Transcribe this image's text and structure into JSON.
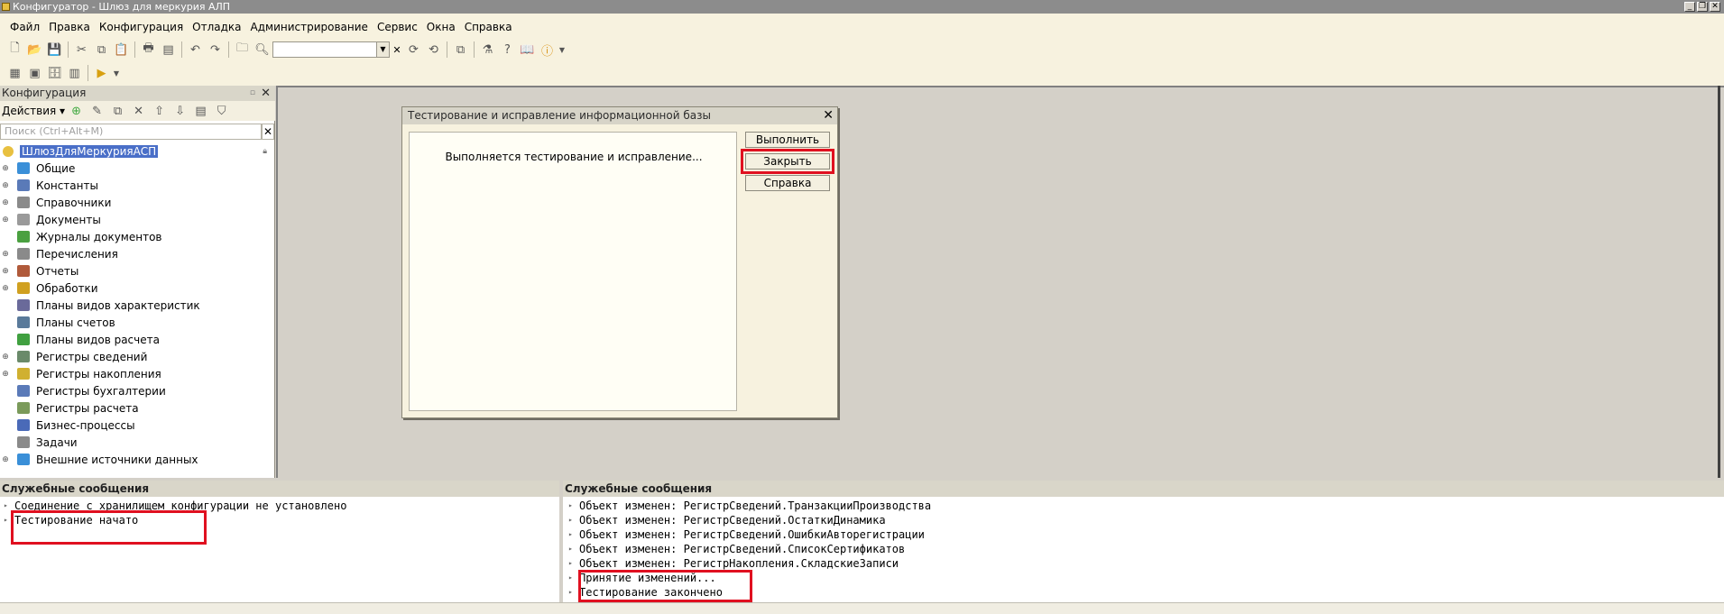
{
  "window": {
    "title": "Конфигуратор - Шлюз для меркурия АЛП"
  },
  "menu": [
    "Файл",
    "Правка",
    "Конфигурация",
    "Отладка",
    "Администрирование",
    "Сервис",
    "Окна",
    "Справка"
  ],
  "config_panel": {
    "title": "Конфигурация",
    "actions_label": "Действия",
    "search_placeholder": "Поиск (Ctrl+Alt+M)",
    "root": "ШлюзДляМеркурияАСП",
    "items": [
      {
        "label": "Общие",
        "expandable": true,
        "icon": "common-icon",
        "color": "#3a8fd8"
      },
      {
        "label": "Константы",
        "expandable": true,
        "icon": "constants-icon",
        "color": "#5a7ab8"
      },
      {
        "label": "Справочники",
        "expandable": true,
        "icon": "catalogs-icon",
        "color": "#8a8a8a"
      },
      {
        "label": "Документы",
        "expandable": true,
        "icon": "documents-icon",
        "color": "#9a9a9a"
      },
      {
        "label": "Журналы документов",
        "expandable": false,
        "icon": "journals-icon",
        "color": "#4aa040"
      },
      {
        "label": "Перечисления",
        "expandable": true,
        "icon": "enums-icon",
        "color": "#8a8a8a"
      },
      {
        "label": "Отчеты",
        "expandable": true,
        "icon": "reports-icon",
        "color": "#b05a3a"
      },
      {
        "label": "Обработки",
        "expandable": true,
        "icon": "dataprocessors-icon",
        "color": "#d0a020"
      },
      {
        "label": "Планы видов характеристик",
        "expandable": false,
        "icon": "charts-of-characteristics-icon",
        "color": "#6a6a9a"
      },
      {
        "label": "Планы счетов",
        "expandable": false,
        "icon": "charts-of-accounts-icon",
        "color": "#5a7a9a"
      },
      {
        "label": "Планы видов расчета",
        "expandable": false,
        "icon": "charts-of-calculation-icon",
        "color": "#40a040"
      },
      {
        "label": "Регистры сведений",
        "expandable": true,
        "icon": "info-registers-icon",
        "color": "#6a8a6a"
      },
      {
        "label": "Регистры накопления",
        "expandable": true,
        "icon": "accum-registers-icon",
        "color": "#d0b030"
      },
      {
        "label": "Регистры бухгалтерии",
        "expandable": false,
        "icon": "accounting-registers-icon",
        "color": "#5a7ab8"
      },
      {
        "label": "Регистры расчета",
        "expandable": false,
        "icon": "calculation-registers-icon",
        "color": "#7a9a5a"
      },
      {
        "label": "Бизнес-процессы",
        "expandable": false,
        "icon": "business-processes-icon",
        "color": "#4a6ab8"
      },
      {
        "label": "Задачи",
        "expandable": false,
        "icon": "tasks-icon",
        "color": "#8a8a8a"
      },
      {
        "label": "Внешние источники данных",
        "expandable": true,
        "icon": "external-sources-icon",
        "color": "#3a8fd8"
      }
    ]
  },
  "dialog": {
    "title": "Тестирование и исправление информационной базы",
    "message": "Выполняется тестирование и исправление...",
    "run_label": "Выполнить",
    "close_label": "Закрыть",
    "help_label": "Справка"
  },
  "messages_left": {
    "title": "Служебные сообщения",
    "lines": [
      "Соединение с хранилищем конфигурации не установлено",
      "Тестирование начато"
    ]
  },
  "messages_right": {
    "title": "Служебные сообщения",
    "lines": [
      "Объект изменен: РегистрСведений.ТранзакцииПроизводства",
      "Объект изменен: РегистрСведений.ОстаткиДинамика",
      "Объект изменен: РегистрСведений.ОшибкиАвторегистрации",
      "Объект изменен: РегистрСведений.СписокСертификатов",
      "Объект изменен: РегистрНакопления.СкладскиеЗаписи",
      "Принятие изменений...",
      "Тестирование закончено"
    ]
  },
  "colors": {
    "highlight": "#e01020",
    "selection": "#4a6fc8"
  }
}
